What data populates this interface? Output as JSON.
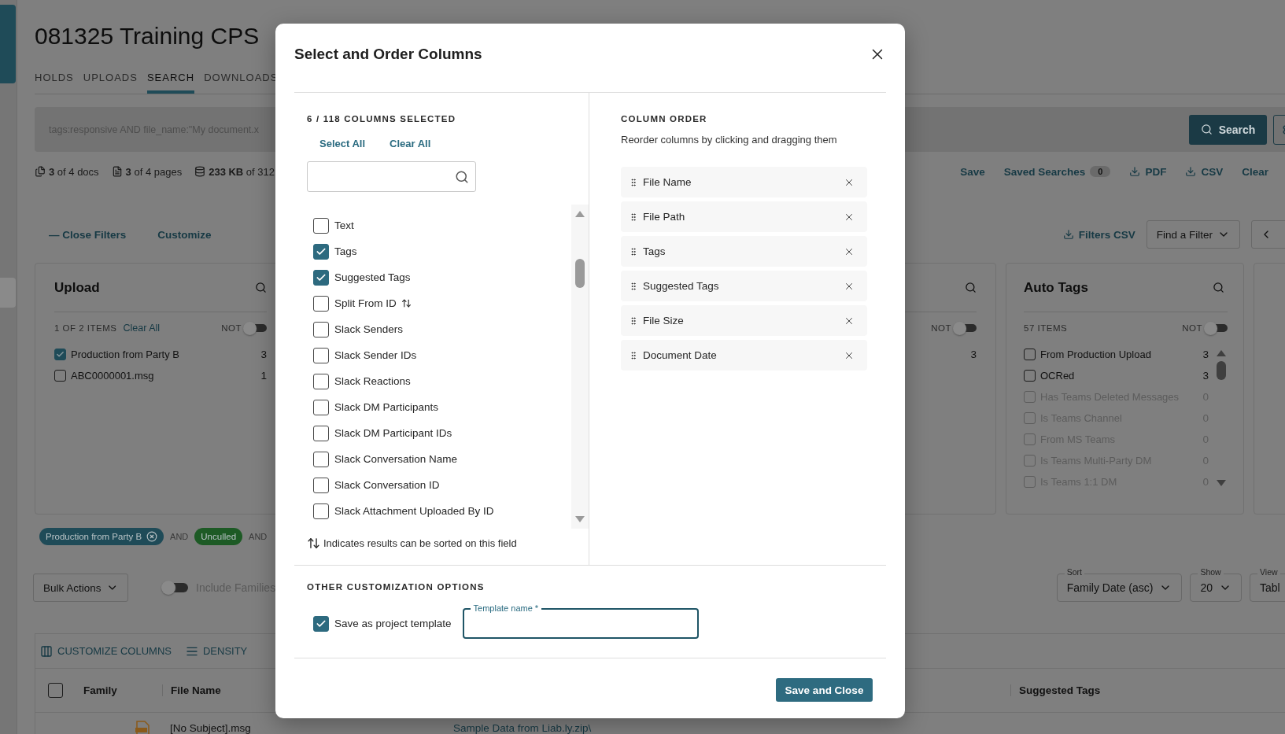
{
  "header": {
    "title": "081325 Training CPS",
    "tabs": [
      {
        "label": "HOLDS",
        "selected": false
      },
      {
        "label": "UPLOADS",
        "selected": false
      },
      {
        "label": "SEARCH",
        "selected": true
      },
      {
        "label": "DOWNLOADS",
        "selected": false
      }
    ]
  },
  "search": {
    "query": "tags:responsive AND file_name:\"My document.x",
    "button": "Search"
  },
  "stats": [
    {
      "kind": "docs",
      "text": "**3** of 4 docs"
    },
    {
      "kind": "pages",
      "text": "**3** of 4 pages"
    },
    {
      "kind": "size",
      "text": "**233 KB** of 312"
    }
  ],
  "actions": [
    {
      "kind": "link",
      "label": "Save"
    },
    {
      "kind": "count",
      "label": "Saved Searches",
      "count": "0"
    },
    {
      "kind": "download",
      "label": "PDF"
    },
    {
      "kind": "download",
      "label": "CSV"
    },
    {
      "kind": "link",
      "label": "Clear"
    }
  ],
  "filters_bar": {
    "close": "— Close Filters",
    "customize": "Customize",
    "csv": "Filters CSV",
    "find": "Find a Filter"
  },
  "upload_panel": {
    "title": "Upload",
    "count": "1 OF 2 ITEMS",
    "clear": "Clear All",
    "not_label": "NOT",
    "not_on": false,
    "items": [
      {
        "label": "Production from Party B",
        "count": "3",
        "checked": true
      },
      {
        "label": "ABC0000001.msg",
        "count": "1",
        "checked": false
      }
    ]
  },
  "hidden_panel": {
    "not_label": "NOT",
    "not_on": false,
    "count": "3"
  },
  "auto_tags_panel": {
    "title": "Auto Tags",
    "count": "57 ITEMS",
    "not_label": "NOT",
    "not_on": false,
    "items": [
      {
        "label": "From Production Upload",
        "count": "3",
        "checked": false,
        "disabled": false
      },
      {
        "label": "OCRed",
        "count": "3",
        "checked": false,
        "disabled": false
      },
      {
        "label": "Has Teams Deleted Messages",
        "count": "0",
        "checked": false,
        "disabled": true
      },
      {
        "label": "Is Teams Channel",
        "count": "0",
        "checked": false,
        "disabled": true
      },
      {
        "label": "From MS Teams",
        "count": "0",
        "checked": false,
        "disabled": true
      },
      {
        "label": "Is Teams Multi-Party DM",
        "count": "0",
        "checked": false,
        "disabled": true
      },
      {
        "label": "Is Teams 1:1 DM",
        "count": "0",
        "checked": false,
        "disabled": true
      }
    ]
  },
  "query_chips": [
    {
      "label": "Production from Party B",
      "color": "#1f4b58",
      "removable": true,
      "joiner": "AND"
    },
    {
      "label": "Unculled",
      "color": "#1d5a25",
      "removable": false,
      "joiner": "AND"
    }
  ],
  "bulk_actions": "Bulk Actions",
  "include_families": {
    "label": "Include Families",
    "on": false
  },
  "selects": [
    {
      "legend": "Sort",
      "value": "Family Date (asc)"
    },
    {
      "legend": "Show",
      "value": "20"
    },
    {
      "legend": "View",
      "value": "Tabl"
    }
  ],
  "table": {
    "all_checked": false,
    "toolbar": [
      {
        "kind": "columns",
        "label": "CUSTOMIZE COLUMNS"
      },
      {
        "kind": "density",
        "label": "DENSITY"
      }
    ],
    "columns": [
      {
        "label": "Family"
      },
      {
        "label": "File Name"
      },
      {
        "label": "Suggested Tags"
      }
    ],
    "rows": [
      {
        "file_name": "[No Subject].msg",
        "file_path": "Sample Data from Liab.ly.zip\\"
      }
    ]
  },
  "modal": {
    "title": "Select and Order Columns",
    "selected_count": "6 / 118 COLUMNS SELECTED",
    "select_all": "Select All",
    "clear_all": "Clear All",
    "columns": [
      {
        "label": "Text",
        "checked": false,
        "sortable": false
      },
      {
        "label": "Tags",
        "checked": true,
        "sortable": false
      },
      {
        "label": "Suggested Tags",
        "checked": true,
        "sortable": false
      },
      {
        "label": "Split From ID",
        "checked": false,
        "sortable": true
      },
      {
        "label": "Slack Senders",
        "checked": false,
        "sortable": false
      },
      {
        "label": "Slack Sender IDs",
        "checked": false,
        "sortable": false
      },
      {
        "label": "Slack Reactions",
        "checked": false,
        "sortable": false
      },
      {
        "label": "Slack DM Participants",
        "checked": false,
        "sortable": false
      },
      {
        "label": "Slack DM Participant IDs",
        "checked": false,
        "sortable": false
      },
      {
        "label": "Slack Conversation Name",
        "checked": false,
        "sortable": false
      },
      {
        "label": "Slack Conversation ID",
        "checked": false,
        "sortable": false
      },
      {
        "label": "Slack Attachment Uploaded By ID",
        "checked": false,
        "sortable": false
      }
    ],
    "sort_note": "Indicates results can be sorted on this field",
    "order_heading": "COLUMN ORDER",
    "order_hint": "Reorder columns by clicking and dragging them",
    "order": [
      "File Name",
      "File Path",
      "Tags",
      "Suggested Tags",
      "File Size",
      "Document Date"
    ],
    "options_heading": "OTHER CUSTOMIZATION OPTIONS",
    "save_template": {
      "label": "Save as project template",
      "checked": true
    },
    "template_field": {
      "label": "Template name *"
    },
    "submit": "Save and Close"
  }
}
